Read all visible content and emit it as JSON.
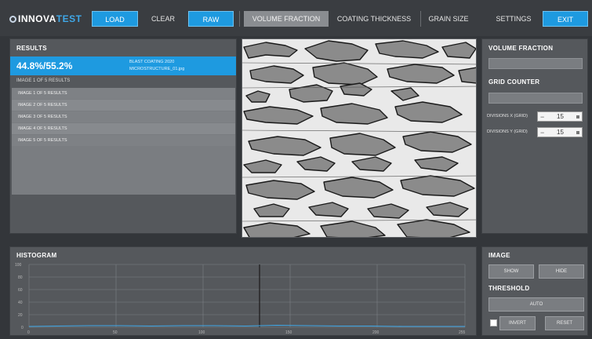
{
  "header": {
    "logo_text": "INNOVA",
    "logo_accent": "TEST",
    "load_label": "LOAD",
    "clear_label": "CLEAR",
    "raw_label": "RAW",
    "volume_fraction_tab": "VOLUME FRACTION",
    "coating_thickness_tab": "COATING THICKNESS",
    "grain_size_tab": "GRAIN SIZE",
    "settings_label": "SETTINGS",
    "exit_label": "EXIT"
  },
  "results": {
    "title": "RESULTS",
    "selected_value": "44.8%/55.2%",
    "selected_files": [
      "BLAST COATING 2020",
      "MICROSTRUCTURE_01.jpg"
    ],
    "caption": "IMAGE 1 OF 5 RESULTS",
    "items": [
      "IMAGE 1 OF 5 RESULTS",
      "IMAGE 2 OF 5 RESULTS",
      "IMAGE 3 OF 5 RESULTS",
      "IMAGE 4 OF 5 RESULTS",
      "IMAGE 5 OF 5 RESULTS"
    ]
  },
  "side": {
    "volume_fraction_title": "VOLUME FRACTION",
    "grid_counter_title": "GRID COUNTER",
    "grid_x_label": "DIVISIONS X (GRID)",
    "grid_x_value": "15",
    "grid_y_label": "DIVISIONS Y (GRID)",
    "grid_y_value": "15"
  },
  "histogram": {
    "title": "HISTOGRAM",
    "y_ticks": [
      "100",
      "80",
      "60",
      "40",
      "20",
      "0"
    ],
    "x_ticks": [
      "0",
      "50",
      "100",
      "150",
      "200",
      "255"
    ]
  },
  "bottom_side": {
    "image_title": "IMAGE",
    "threshold_title": "THRESHOLD",
    "btn_a": "SHOW",
    "btn_b": "HIDE",
    "btn_c": "AUTO",
    "btn_d": "INVERT",
    "btn_e": "RESET"
  },
  "colors": {
    "accent": "#1e9ae0",
    "panel": "#55585c",
    "background": "#33363a"
  }
}
